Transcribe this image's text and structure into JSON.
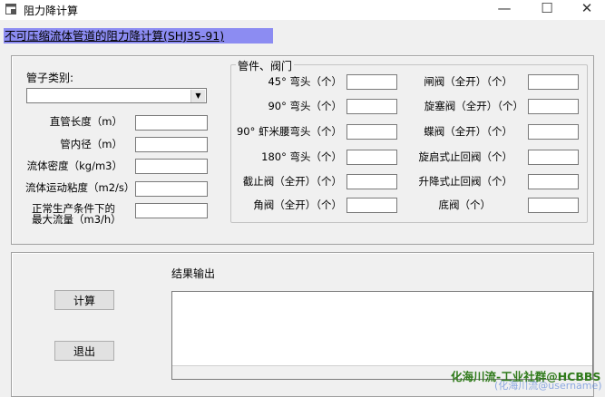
{
  "window": {
    "title": "阻力降计算",
    "minimize_glyph": "—",
    "maximize_glyph": "☐",
    "close_glyph": "✕"
  },
  "banner": "不可压缩流体管道的阻力降计算(SHJ35-91)",
  "left_panel": {
    "pipe_type_label": "管子类别:",
    "pipe_type_value": "",
    "fields": [
      {
        "label": "直管长度（m）",
        "value": ""
      },
      {
        "label": "管内径（m）",
        "value": ""
      },
      {
        "label": "流体密度（kg/m3）",
        "value": ""
      },
      {
        "label": "流体运动粘度（m2/s）",
        "value": ""
      },
      {
        "label_line1": "正常生产条件下的",
        "label_line2": "最大流量（m3/h）",
        "value": ""
      }
    ]
  },
  "fittings_group": {
    "title": "管件、阀门",
    "left_items": [
      {
        "label": "45° 弯头（个）",
        "value": ""
      },
      {
        "label": "90° 弯头（个）",
        "value": ""
      },
      {
        "label": "90° 虾米腰弯头（个）",
        "value": ""
      },
      {
        "label": "180° 弯头（个）",
        "value": ""
      },
      {
        "label": "截止阀（全开）（个）",
        "value": ""
      },
      {
        "label": "角阀（全开）（个）",
        "value": ""
      }
    ],
    "right_items": [
      {
        "label": "闸阀（全开）（个）",
        "value": ""
      },
      {
        "label": "旋塞阀（全开）（个）",
        "value": ""
      },
      {
        "label": "蝶阀（全开）（个）",
        "value": ""
      },
      {
        "label": "旋启式止回阀（个）",
        "value": ""
      },
      {
        "label": "升降式止回阀（个）",
        "value": ""
      },
      {
        "label": "底阀（个）",
        "value": ""
      }
    ]
  },
  "bottom_panel": {
    "calculate_label": "计算",
    "exit_label": "退出",
    "result_label": "结果输出",
    "result_value": ""
  },
  "watermark": "化海川流-工业社群@HCBBS",
  "watermark_sub": "(化海川流@username)"
}
